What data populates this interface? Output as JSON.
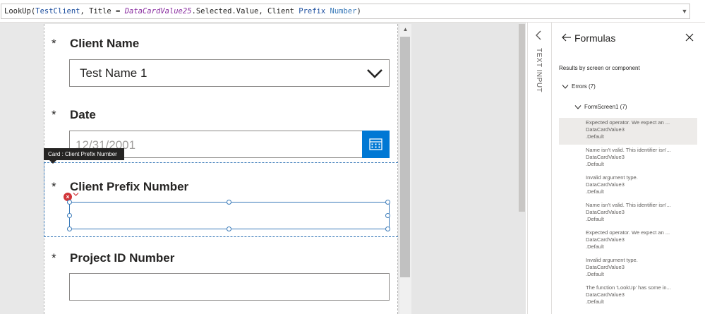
{
  "formula_bar": {
    "tokens": [
      {
        "text": "LookUp(",
        "style": "normal"
      },
      {
        "text": "TestClient",
        "style": "var"
      },
      {
        "text": ", Title = ",
        "style": "normal"
      },
      {
        "text": "DataCardValue25",
        "style": "ital"
      },
      {
        "text": ".Selected.Value, Client ",
        "style": "normal"
      },
      {
        "text": "Prefix",
        "style": "var"
      },
      {
        "text": " ",
        "style": "normal"
      },
      {
        "text": "Number",
        "style": "num"
      },
      {
        "text": ")",
        "style": "normal"
      }
    ],
    "dropdown_icon": "chevron-down-icon"
  },
  "form": {
    "required_mark": "*",
    "client_name": {
      "label": "Client Name",
      "value": "Test Name 1"
    },
    "date": {
      "label": "Date",
      "value": "12/31/2001"
    },
    "client_prefix": {
      "label": "Client Prefix Number",
      "value": ""
    },
    "project_id": {
      "label": "Project ID Number",
      "value": ""
    }
  },
  "card_tooltip": "Card : Client Prefix Number",
  "side_strip": {
    "label": "TEXT INPUT"
  },
  "formulas_panel": {
    "title": "Formulas",
    "subtitle": "Results by screen or component",
    "errors_group": "Errors (7)",
    "screen_group": "FormScreen1 (7)",
    "errors": [
      {
        "message": "Expected operator. We expect an ...",
        "control": "DataCardValue3",
        "property": ".Default"
      },
      {
        "message": "Name isn't valid. This identifier isn'...",
        "control": "DataCardValue3",
        "property": ".Default"
      },
      {
        "message": "Invalid argument type.",
        "control": "DataCardValue3",
        "property": ".Default"
      },
      {
        "message": "Name isn't valid. This identifier isn'...",
        "control": "DataCardValue3",
        "property": ".Default"
      },
      {
        "message": "Expected operator. We expect an ...",
        "control": "DataCardValue3",
        "property": ".Default"
      },
      {
        "message": "Invalid argument type.",
        "control": "DataCardValue3",
        "property": ".Default"
      },
      {
        "message": "The function 'LookUp' has some in...",
        "control": "DataCardValue3",
        "property": ".Default"
      }
    ]
  },
  "colors": {
    "accent": "#0078d4",
    "selection": "#3a7ab9",
    "error": "#d13438"
  }
}
